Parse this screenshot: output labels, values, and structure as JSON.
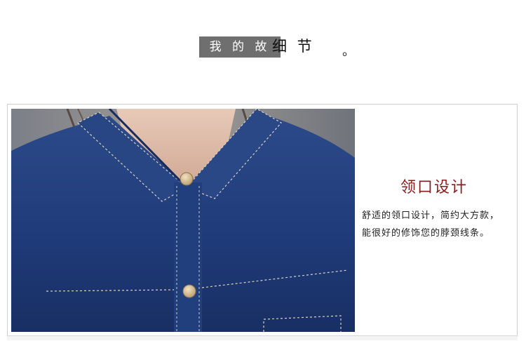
{
  "header": {
    "tag_text": "我 的 故 事",
    "rest_text": "细 节",
    "dot": "。"
  },
  "detail": {
    "heading": "领口设计",
    "lines": [
      "舒适的领口设计，简约大方款，",
      "能很好的修饰您的脖颈线条。"
    ]
  },
  "colors": {
    "tag_bg": "#6f6f6f",
    "heading": "#8b1b1b",
    "denim": "#1f3a78"
  }
}
